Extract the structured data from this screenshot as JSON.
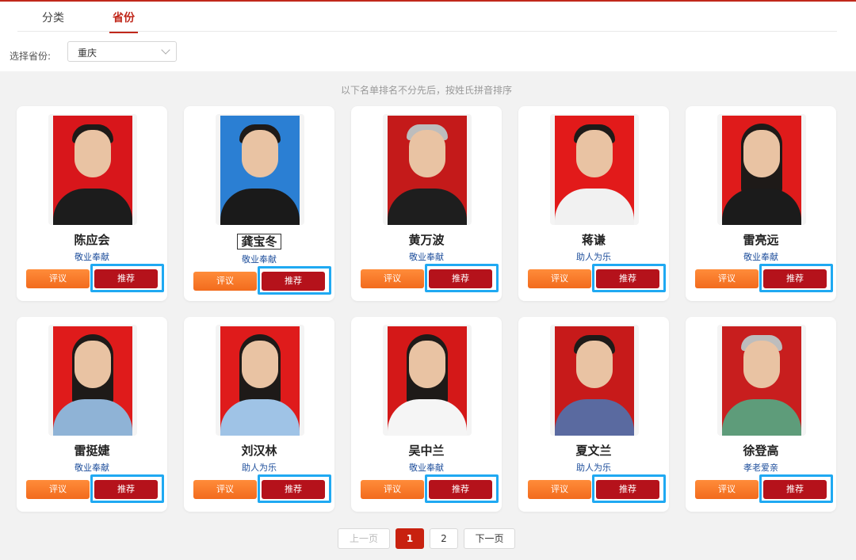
{
  "tabs": [
    "分类",
    "省份"
  ],
  "filter": {
    "label": "选择省份:",
    "value": "重庆"
  },
  "notice": "以下名单排名不分先后，按姓氏拼音排序",
  "buttons": {
    "comment": "评议",
    "recommend": "推荐"
  },
  "people": [
    {
      "name": "陈应会",
      "motto": "敬业奉献"
    },
    {
      "name": "龚宝冬",
      "motto": "敬业奉献"
    },
    {
      "name": "黄万波",
      "motto": "敬业奉献"
    },
    {
      "name": "蒋谦",
      "motto": "助人为乐"
    },
    {
      "name": "雷亮远",
      "motto": "敬业奉献"
    },
    {
      "name": "雷挺婕",
      "motto": "敬业奉献"
    },
    {
      "name": "刘汉林",
      "motto": "助人为乐"
    },
    {
      "name": "吴中兰",
      "motto": "敬业奉献"
    },
    {
      "name": "夏文兰",
      "motto": "助人为乐"
    },
    {
      "name": "徐登高",
      "motto": "孝老爱亲"
    }
  ],
  "pagination": {
    "prev": "上一页",
    "pages": [
      "1",
      "2"
    ],
    "next": "下一页"
  },
  "colors": {
    "brand": "#c0281b",
    "recommend": "#b5121b",
    "comment": "#f26b1d",
    "highlight": "#1fa9f2",
    "motto": "#1f4f9c"
  }
}
